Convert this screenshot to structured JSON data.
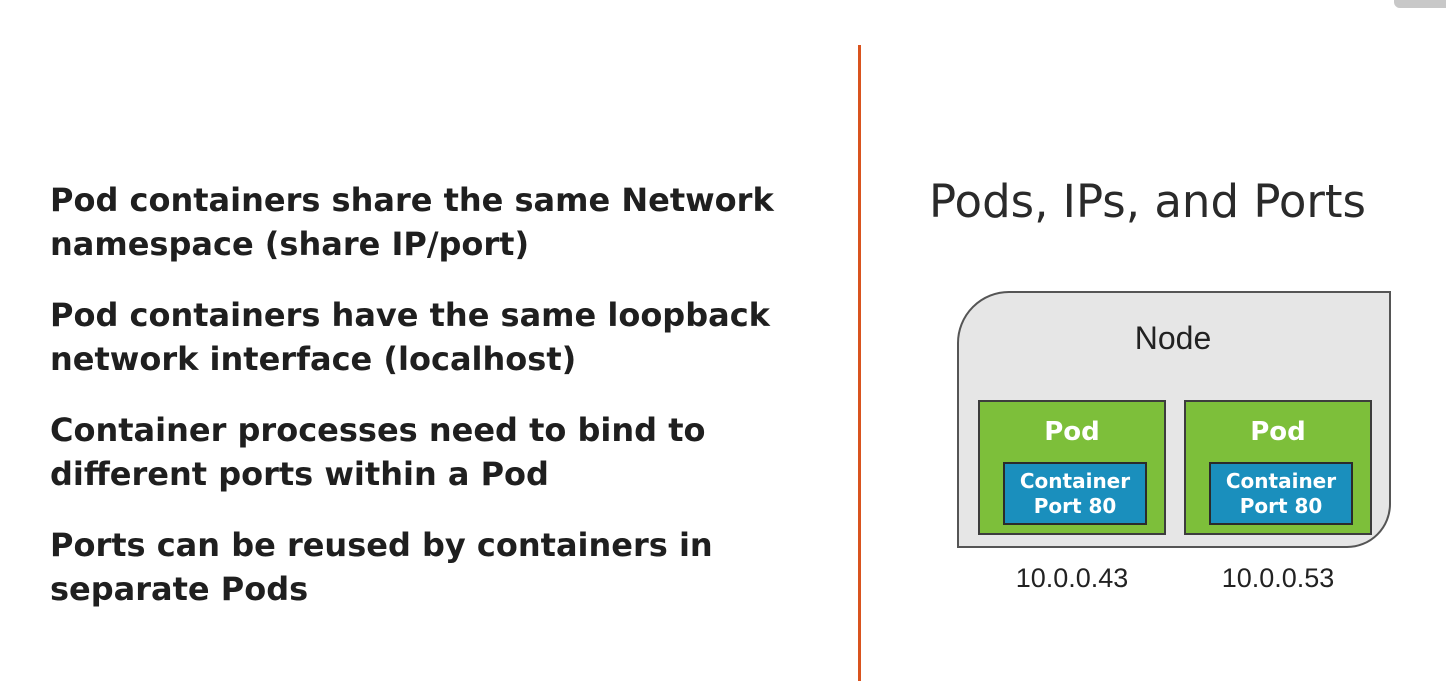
{
  "bullets": [
    {
      "line1": "Pod containers share the same Network",
      "line2": "namespace (share IP/port)"
    },
    {
      "line1": "Pod containers have the same loopback",
      "line2": "network interface (localhost)"
    },
    {
      "line1": "Container processes need to bind to",
      "line2": "different ports within a Pod"
    },
    {
      "line1": "Ports can be reused by containers in",
      "line2": "separate Pods"
    }
  ],
  "title": "Pods, IPs, and Ports",
  "diagram": {
    "node_label": "Node",
    "pods": [
      {
        "label": "Pod",
        "container_line1": "Container",
        "container_line2": "Port 80",
        "ip": "10.0.0.43"
      },
      {
        "label": "Pod",
        "container_line1": "Container",
        "container_line2": "Port 80",
        "ip": "10.0.0.53"
      }
    ]
  },
  "colors": {
    "divider": "#d9531e",
    "pod": "#7dbf3a",
    "container": "#1a8fbd",
    "node": "#e6e6e6"
  }
}
